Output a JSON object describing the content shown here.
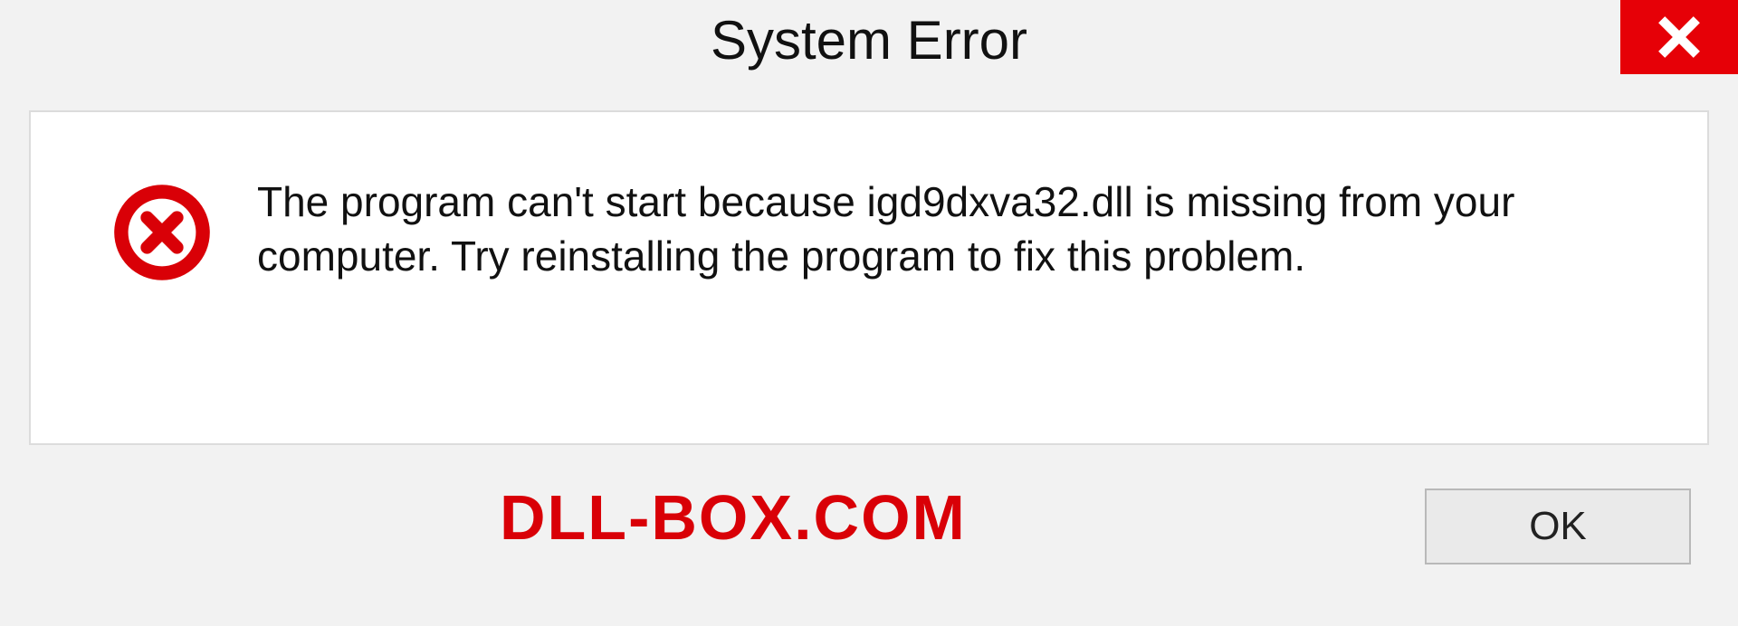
{
  "title": "System Error",
  "message": "The program can't start because igd9dxva32.dll is missing from your computer. Try reinstalling the program to fix this problem.",
  "watermark": "DLL-BOX.COM",
  "buttons": {
    "ok": "OK"
  },
  "colors": {
    "accent_red": "#e60007",
    "bg": "#f2f2f2"
  }
}
